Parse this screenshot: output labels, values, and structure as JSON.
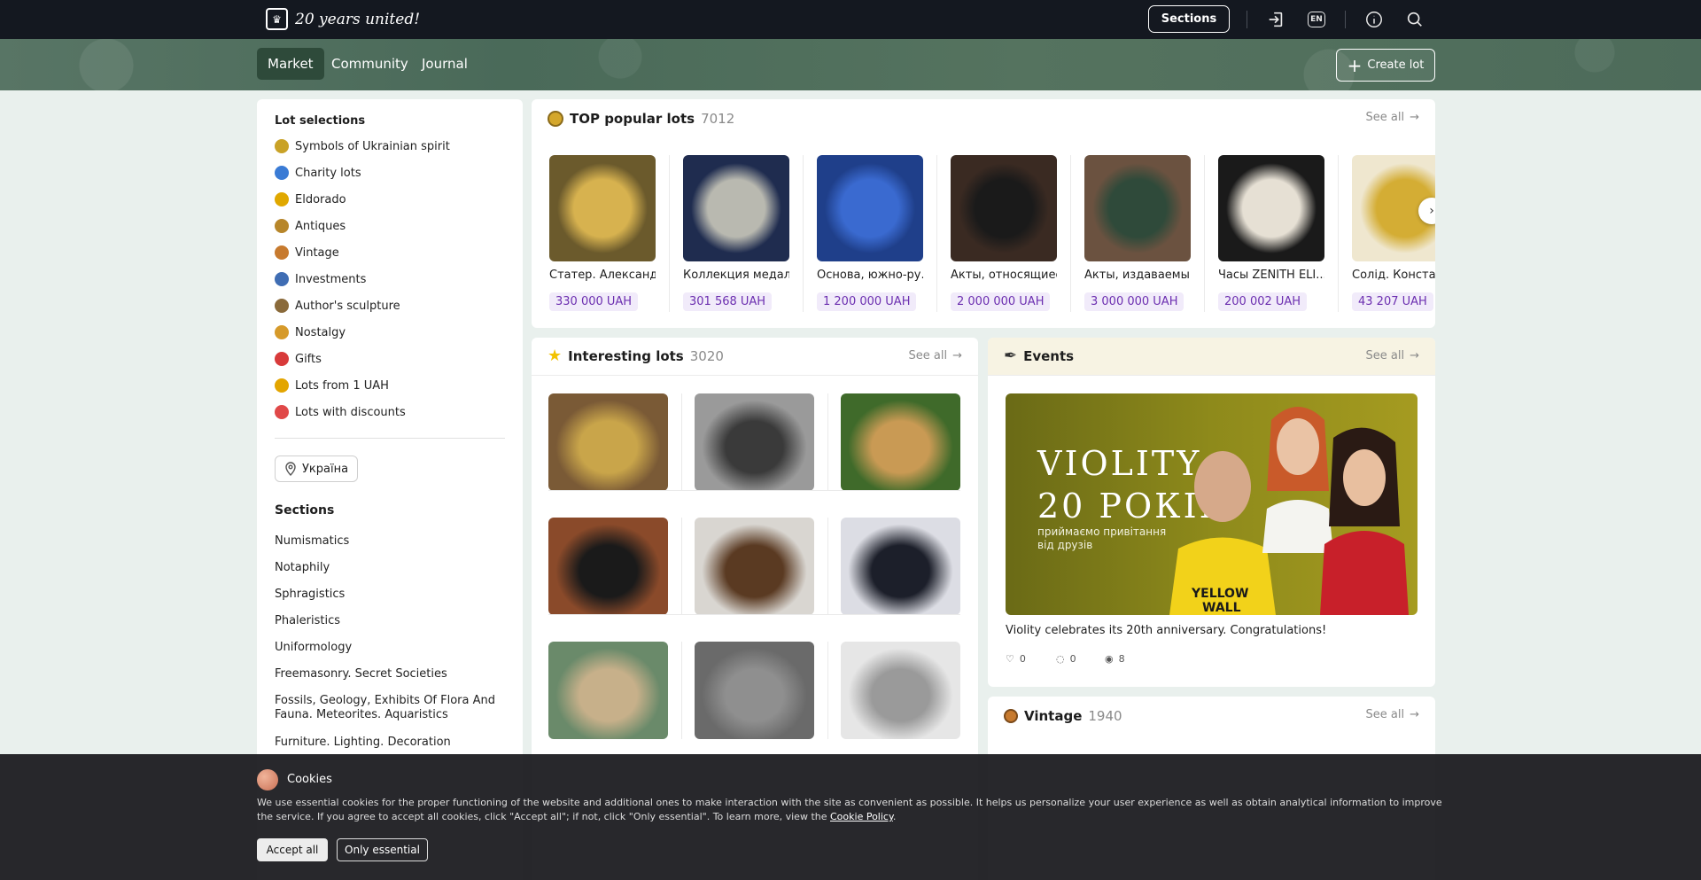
{
  "header": {
    "logo_text": "20 years united!",
    "sections_label": "Sections",
    "lang": "EN"
  },
  "nav": {
    "tabs": [
      "Market",
      "Community",
      "Journal"
    ],
    "create_lot": "Create lot"
  },
  "sidebar": {
    "lot_selections_title": "Lot selections",
    "items": [
      {
        "label": "Symbols of Ukrainian spirit",
        "icon": "trident-icon",
        "color": "#c9a227"
      },
      {
        "label": "Charity lots",
        "icon": "heart-icon",
        "color": "#3a7bd5"
      },
      {
        "label": "Eldorado",
        "icon": "gold-coin-icon",
        "color": "#e0a800"
      },
      {
        "label": "Antiques",
        "icon": "vase-icon",
        "color": "#b7862a"
      },
      {
        "label": "Vintage",
        "icon": "vintage-icon",
        "color": "#c77a2e"
      },
      {
        "label": "Investments",
        "icon": "bank-icon",
        "color": "#3f6db3"
      },
      {
        "label": "Author's sculpture",
        "icon": "sculpture-icon",
        "color": "#8a6a3a"
      },
      {
        "label": "Nostalgy",
        "icon": "nostalgy-icon",
        "color": "#d69a2a"
      },
      {
        "label": "Gifts",
        "icon": "gift-icon",
        "color": "#d83a3a"
      },
      {
        "label": "Lots from 1 UAH",
        "icon": "coin-one-icon",
        "color": "#e3a500"
      },
      {
        "label": "Lots with discounts",
        "icon": "discount-icon",
        "color": "#e04848"
      }
    ],
    "location": "Україна",
    "sections_title": "Sections",
    "sections": [
      "Numismatics",
      "Notaphily",
      "Sphragistics",
      "Phaleristics",
      "Uniformology",
      "Freemasonry. Secret Societies",
      "Fossils, Geology, Exhibits Of Flora And Fauna. Meteorites. Aquaristics",
      "Furniture. Lighting. Decoration"
    ]
  },
  "top_lots": {
    "title": "TOP popular lots",
    "count": "7012",
    "see_all": "See all",
    "lots": [
      {
        "name": "Статер. Александ...",
        "price": "330 000 UAH",
        "bg": "#6b5a2c",
        "fg": "#d7b24f"
      },
      {
        "name": "Коллекция медал...",
        "price": "301 568 UAH",
        "bg": "#1f2c4f",
        "fg": "#b9b9b0"
      },
      {
        "name": "Основа, южно-ру...",
        "price": "1 200 000 UAH",
        "bg": "#1f3f8a",
        "fg": "#3a6ad0"
      },
      {
        "name": "Акты, относящиес...",
        "price": "2 000 000 UAH",
        "bg": "#3a2a22",
        "fg": "#1a1a1a"
      },
      {
        "name": "Акты, издаваемы...",
        "price": "3 000 000 UAH",
        "bg": "#6b5240",
        "fg": "#2f4a3a"
      },
      {
        "name": "Часы ZENITH ELI...",
        "price": "200 002 UAH",
        "bg": "#1a1a1a",
        "fg": "#e6e0d4"
      },
      {
        "name": "Солід. Констанц...",
        "price": "43 207 UAH",
        "bg": "#efe7cf",
        "fg": "#d4ad34"
      }
    ]
  },
  "interesting": {
    "title": "Interesting lots",
    "count": "3020",
    "see_all": "See all",
    "lots": [
      {
        "bg": "#7a5a36",
        "fg": "#c9a54a"
      },
      {
        "bg": "#9a9a9a",
        "fg": "#3a3a3a"
      },
      {
        "bg": "#3f6a2a",
        "fg": "#c99a54"
      },
      {
        "bg": "#8a4a2a",
        "fg": "#1a1a1a"
      },
      {
        "bg": "#d9d6d1",
        "fg": "#5a3a22"
      },
      {
        "bg": "#dcdde4",
        "fg": "#1c1f2a"
      },
      {
        "bg": "#6a8a6a",
        "fg": "#c7b08a"
      },
      {
        "bg": "#6a6a6a",
        "fg": "#8f8f8f"
      },
      {
        "bg": "#e6e6e6",
        "fg": "#9a9a9a"
      }
    ]
  },
  "events": {
    "title": "Events",
    "see_all": "See all",
    "banner_line1": "VIOLITY",
    "banner_line2": "20 РОКІВ",
    "banner_sub1": "приймаємо привітання",
    "banner_sub2": "від друзів",
    "banner_shirt1": "YELLOW",
    "banner_shirt2": "WALL",
    "caption": "Violity celebrates its 20th anniversary. Congratulations!",
    "likes": "0",
    "comments": "0",
    "views": "8"
  },
  "vintage": {
    "title": "Vintage",
    "count": "1940",
    "see_all": "See all"
  },
  "cookies": {
    "title": "Cookies",
    "text": "We use essential cookies for the proper functioning of the website and additional ones to make interaction with the site as convenient as possible. It helps us personalize your user experience as well as obtain analytical information to improve the service. If you agree to accept all cookies, click \"Accept all\"; if not, click \"Only essential\". To learn more, view the",
    "policy_link": "Cookie Policy",
    "accept_all": "Accept all",
    "only_essential": "Only essential"
  }
}
